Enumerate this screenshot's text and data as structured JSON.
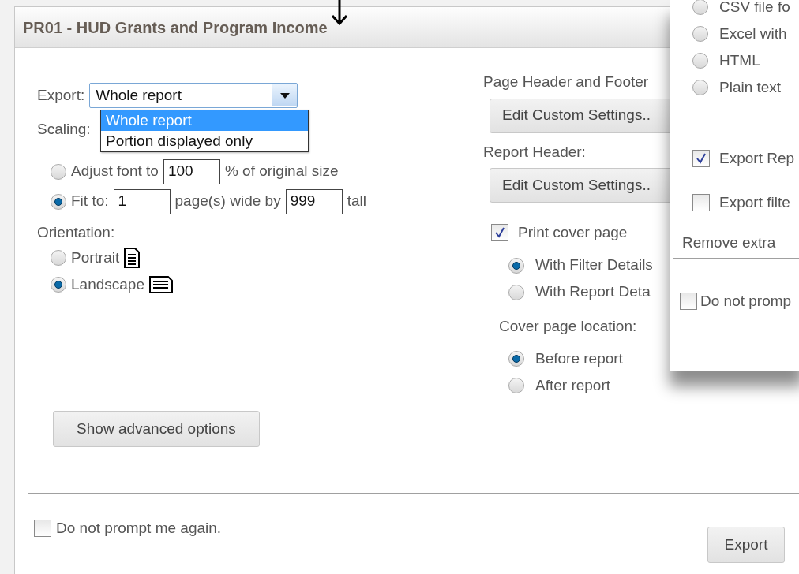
{
  "dialog": {
    "title": "PR01 - HUD Grants and Program Income"
  },
  "export": {
    "label": "Export:",
    "value": "Whole report",
    "options": [
      {
        "label": "Whole report",
        "selected": true
      },
      {
        "label": "Portion displayed only",
        "selected": false
      }
    ]
  },
  "scaling": {
    "label": "Scaling:",
    "options": [
      {
        "selected": false,
        "parts": [
          {
            "kind": "text",
            "text": "Adjust font to"
          },
          {
            "kind": "field",
            "text": "100"
          },
          {
            "kind": "text",
            "text": "% of original size"
          }
        ]
      },
      {
        "selected": true,
        "parts": [
          {
            "kind": "text",
            "text": "Fit to:"
          },
          {
            "kind": "field",
            "text": "1"
          },
          {
            "kind": "text",
            "text": "page(s) wide by"
          },
          {
            "kind": "field",
            "text": "999"
          },
          {
            "kind": "text",
            "text": "tall"
          }
        ]
      }
    ]
  },
  "orientation": {
    "label": "Orientation:",
    "options": [
      {
        "label": "Portrait",
        "selected": false,
        "kind": "portrait"
      },
      {
        "label": "Landscape",
        "selected": true,
        "kind": "landscape"
      }
    ]
  },
  "advanced_button": "Show advanced options",
  "page_header": {
    "label": "Page Header and Footer",
    "button": "Edit Custom Settings.."
  },
  "report_header": {
    "label": "Report Header:",
    "button": "Edit Custom Settings.."
  },
  "cover_page": {
    "label": "Print cover page",
    "checked": true,
    "details": [
      {
        "label": "With Filter Details",
        "selected": true
      },
      {
        "label": "With Report Deta",
        "selected": false
      }
    ],
    "location_label": "Cover page location:",
    "locations": [
      {
        "label": "Before report",
        "selected": true
      },
      {
        "label": "After report",
        "selected": false
      }
    ]
  },
  "do_not_prompt": {
    "label": "Do not prompt me again.",
    "checked": false
  },
  "export_button": "Export",
  "second_dialog": {
    "formats": [
      {
        "label": "CSV file fo",
        "selected": false
      },
      {
        "label": "Excel with",
        "selected": false
      },
      {
        "label": "HTML",
        "selected": false
      },
      {
        "label": "Plain text",
        "selected": false
      }
    ],
    "options": [
      {
        "label": "Export Rep",
        "checked": true
      },
      {
        "label": "Export filte",
        "checked": false
      }
    ],
    "remove_label": "Remove extra",
    "do_not_prompt": {
      "label": "Do not promp",
      "checked": false
    }
  }
}
